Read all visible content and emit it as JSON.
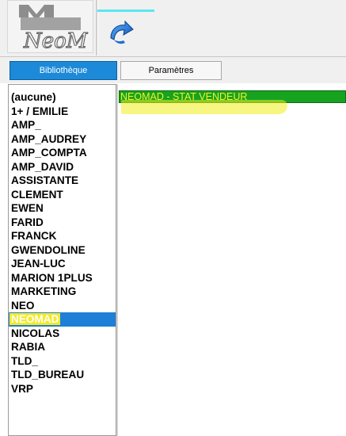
{
  "toolbar": {
    "logo_icon": "neomad-logo-icon",
    "run_icon": "run-report-icon"
  },
  "tabs": [
    {
      "label": "Bibliothèque",
      "active": true
    },
    {
      "label": "Paramètres",
      "active": false
    }
  ],
  "library": {
    "items": [
      "(aucune)",
      "1+ / EMILIE",
      "AMP_",
      "AMP_AUDREY",
      "AMP_COMPTA",
      "AMP_DAVID",
      "ASSISTANTE",
      "CLEMENT",
      "EWEN",
      "FARID",
      "FRANCK",
      "GWENDOLINE",
      "JEAN-LUC",
      "MARION 1PLUS",
      "MARKETING",
      "NEO",
      "NEOMAD",
      "NICOLAS",
      "RABIA",
      "TLD_",
      "TLD_BUREAU",
      "VRP"
    ],
    "selected": "NEOMAD"
  },
  "reports": {
    "items": [
      "NEOMAD - STAT VENDEUR"
    ]
  },
  "colors": {
    "tab_active": "#1c8ad8",
    "selection": "#1e7fd6",
    "report_row": "#17a320",
    "report_text": "#f7ef25",
    "highlight": "#f3ee1e"
  }
}
